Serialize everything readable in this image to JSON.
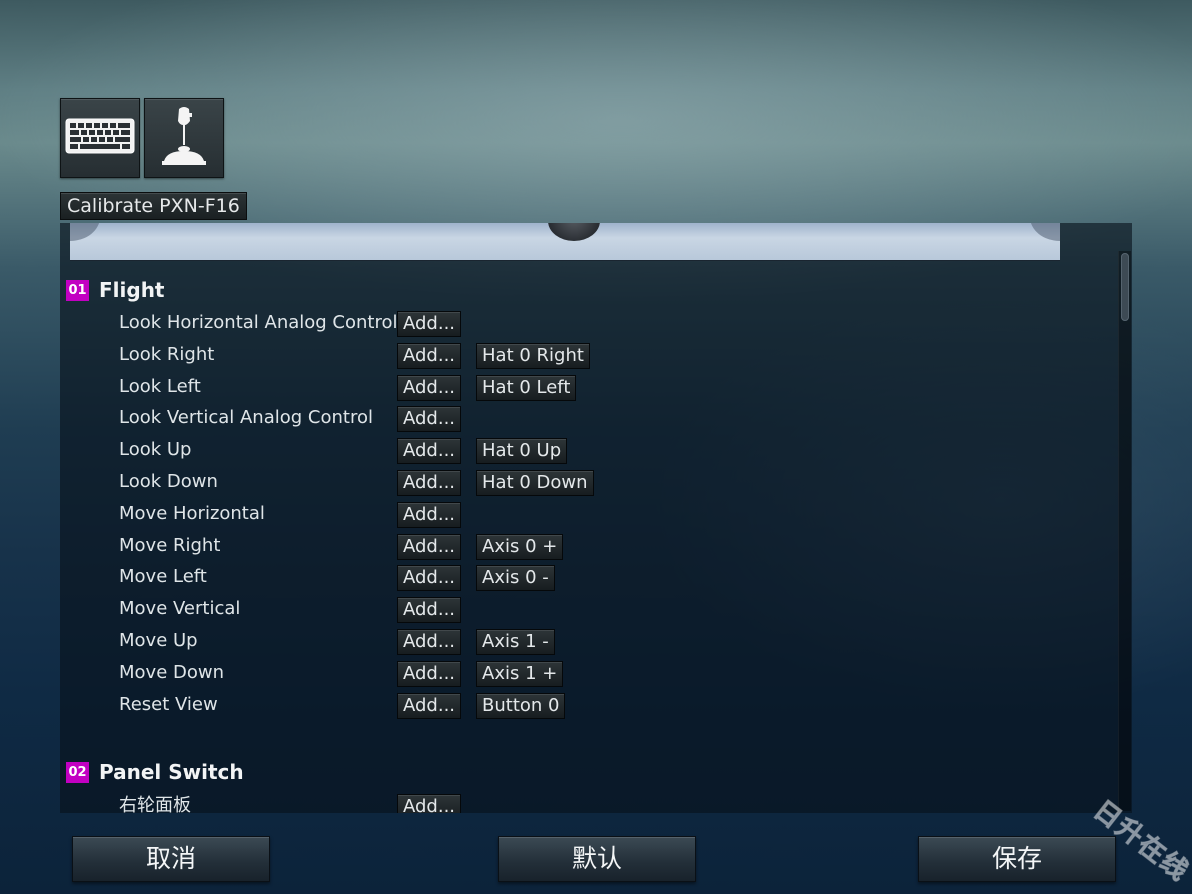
{
  "header": {
    "keyboard_icon": "keyboard-icon",
    "joystick_icon": "joystick-icon",
    "calibrate_label": "Calibrate PXN-F16"
  },
  "sections": [
    {
      "number": "01",
      "title": "Flight",
      "rows": [
        {
          "label": "Look Horizontal Analog Control",
          "add": "Add...",
          "binding": ""
        },
        {
          "label": "Look Right",
          "add": "Add...",
          "binding": "Hat 0 Right"
        },
        {
          "label": "Look Left",
          "add": "Add...",
          "binding": "Hat 0 Left"
        },
        {
          "label": "Look Vertical Analog Control",
          "add": "Add...",
          "binding": ""
        },
        {
          "label": "Look Up",
          "add": "Add...",
          "binding": "Hat 0 Up"
        },
        {
          "label": "Look Down",
          "add": "Add...",
          "binding": "Hat 0 Down"
        },
        {
          "label": "Move Horizontal",
          "add": "Add...",
          "binding": ""
        },
        {
          "label": "Move Right",
          "add": "Add...",
          "binding": "Axis 0 +"
        },
        {
          "label": "Move Left",
          "add": "Add...",
          "binding": "Axis 0 -"
        },
        {
          "label": "Move Vertical",
          "add": "Add...",
          "binding": ""
        },
        {
          "label": "Move Up",
          "add": "Add...",
          "binding": "Axis 1 -"
        },
        {
          "label": "Move Down",
          "add": "Add...",
          "binding": "Axis 1 +"
        },
        {
          "label": "Reset View",
          "add": "Add...",
          "binding": "Button 0"
        }
      ]
    },
    {
      "number": "02",
      "title": "Panel Switch",
      "rows": [
        {
          "label": "右轮面板",
          "add": "Add...",
          "binding": ""
        }
      ]
    }
  ],
  "footer": {
    "cancel_label": "取消",
    "default_label": "默认",
    "save_label": "保存"
  },
  "watermark": "日升在线",
  "colors": {
    "section_badge": "#c200c2",
    "accent_text": "#f2f4f5"
  }
}
